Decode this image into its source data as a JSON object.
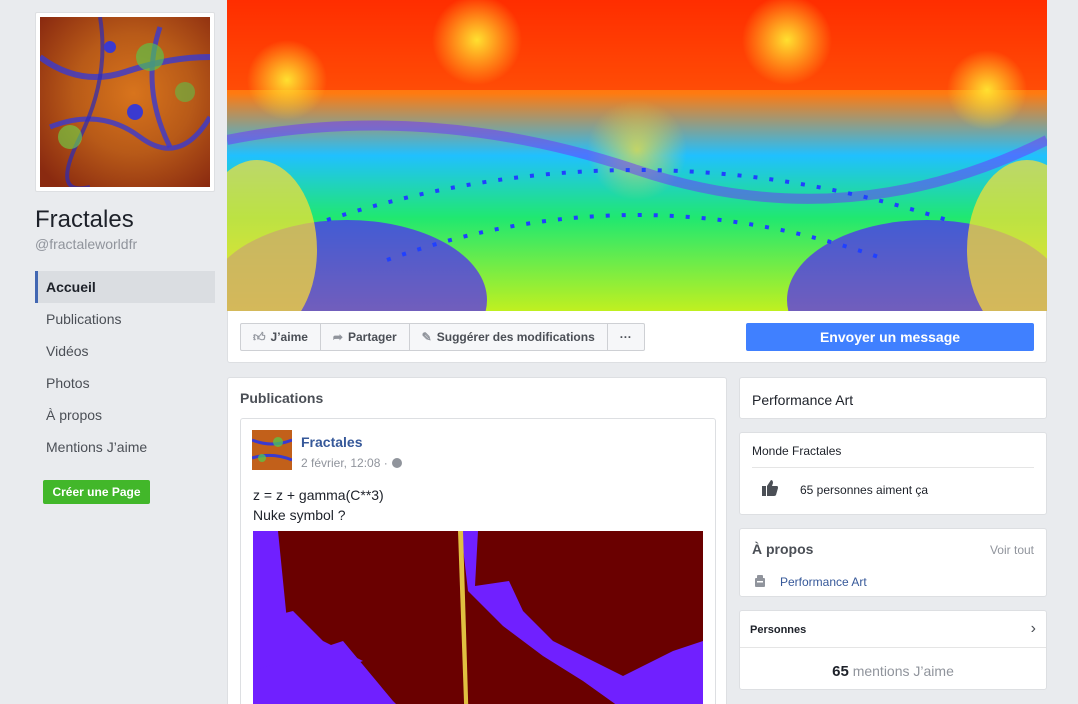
{
  "page": {
    "name": "Fractales",
    "handle": "@fractaleworldfr"
  },
  "nav": {
    "items": [
      {
        "label": "Accueil",
        "active": true
      },
      {
        "label": "Publications"
      },
      {
        "label": "Vidéos"
      },
      {
        "label": "Photos"
      },
      {
        "label": "À propos"
      },
      {
        "label": "Mentions J’aime"
      }
    ],
    "create_page": "Créer une Page"
  },
  "actions": {
    "like": "J’aime",
    "share": "Partager",
    "suggest": "Suggérer des modifications",
    "more": "···",
    "message": "Envoyer un message"
  },
  "publications": {
    "title": "Publications",
    "post": {
      "author": "Fractales",
      "date": "2 février, 12:08 · ",
      "line1": "z = z + gamma(C**3)",
      "line2": "Nuke symbol ?"
    }
  },
  "sidebar": {
    "category": "Performance Art",
    "community": {
      "title": "Monde Fractales",
      "likes": "65 personnes aiment ça"
    },
    "about": {
      "title": "À propos",
      "see_all": "Voir tout",
      "category_link": "Performance Art"
    },
    "people": {
      "title": "Personnes",
      "count": "65",
      "count_label": " mentions J’aime"
    }
  },
  "colors": {
    "accent": "#4080ff",
    "link": "#365899",
    "green": "#42b72a",
    "bg": "#e9ebee"
  }
}
